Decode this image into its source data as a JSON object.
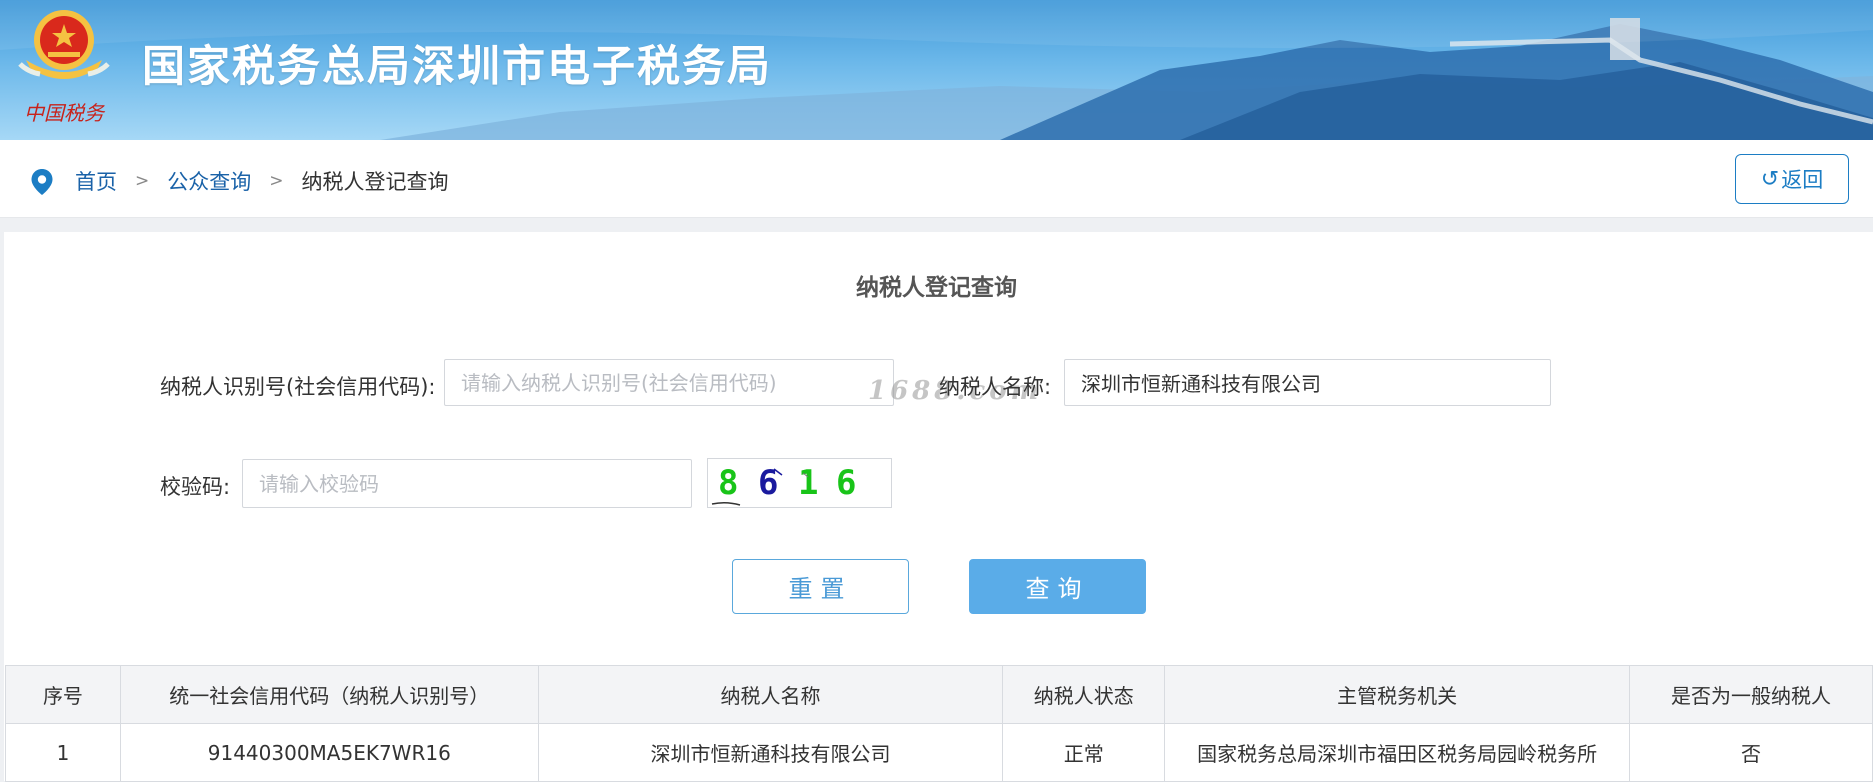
{
  "header": {
    "emblem_text": "中国税务",
    "title": "国家税务总局深圳市电子税务局"
  },
  "breadcrumb": {
    "home": "首页",
    "separator": ">",
    "section": "公众查询",
    "current": "纳税人登记查询"
  },
  "back_button": {
    "icon": "↺",
    "label": "返回"
  },
  "form": {
    "title": "纳税人登记查询",
    "taxpayer_id": {
      "label": "纳税人识别号(社会信用代码):",
      "placeholder": "请输入纳税人识别号(社会信用代码)",
      "value": ""
    },
    "taxpayer_name": {
      "label": "纳税人名称:",
      "placeholder": "",
      "value": "深圳市恒新通科技有限公司"
    },
    "captcha": {
      "label": "校验码:",
      "placeholder": "请输入校验码",
      "value": "",
      "image_chars": [
        "8",
        "6",
        "1",
        "6"
      ],
      "image_colors": [
        "#19c419",
        "#1a1a9e",
        "#19c419",
        "#19c419"
      ]
    },
    "reset_button": "重置",
    "query_button": "查询"
  },
  "watermark": "1688.com",
  "results": {
    "columns": [
      "序号",
      "统一社会信用代码（纳税人识别号）",
      "纳税人名称",
      "纳税人状态",
      "主管税务机关",
      "是否为一般纳税人"
    ],
    "rows": [
      [
        "1",
        "91440300MA5EK7WR16",
        "深圳市恒新通科技有限公司",
        "正常",
        "国家税务总局深圳市福田区税务局园岭税务所",
        "否"
      ]
    ]
  },
  "colors": {
    "brand_blue": "#1c7dc4",
    "link_blue": "#1a62a8",
    "query_button": "#5aace8",
    "banner_top": "#3f98d8"
  }
}
